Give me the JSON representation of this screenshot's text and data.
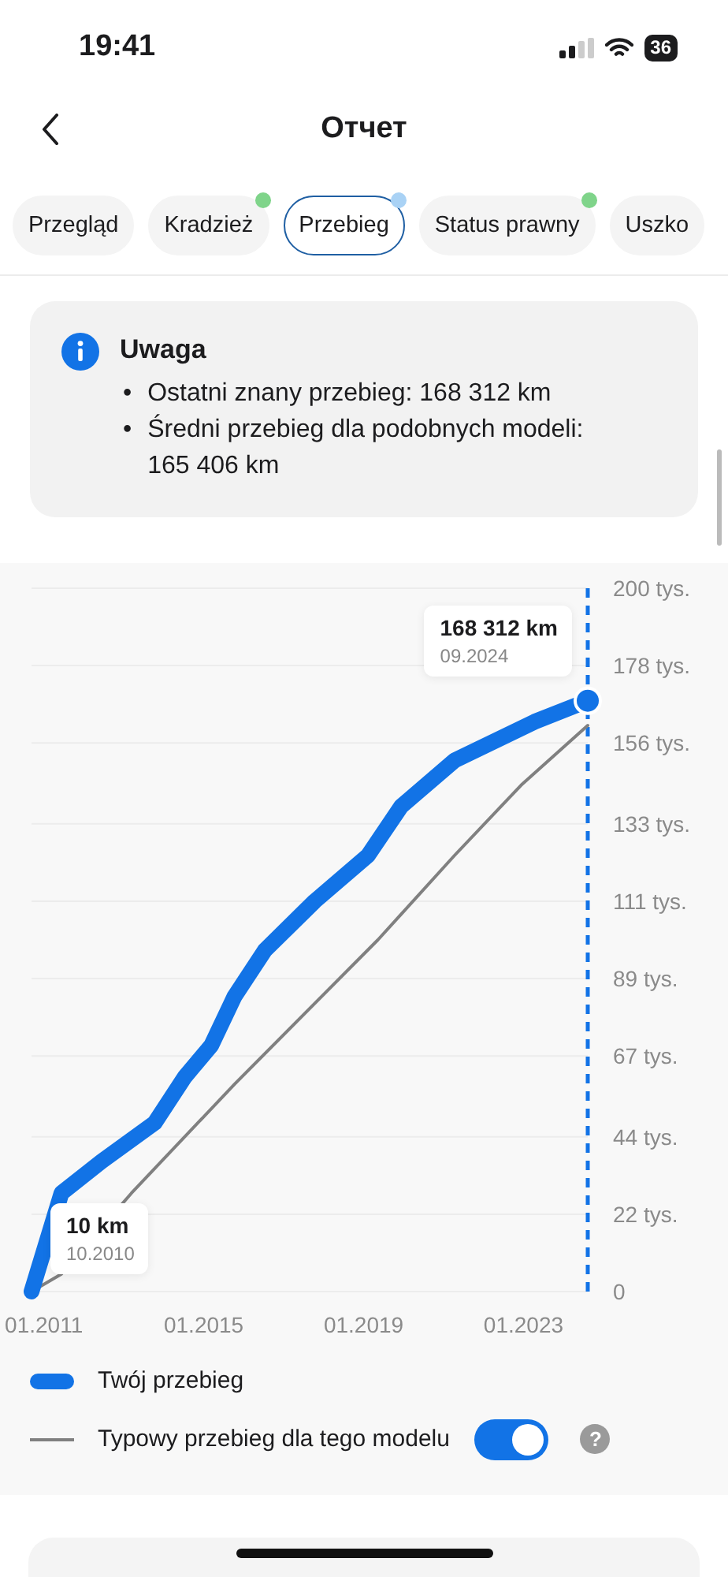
{
  "status_bar": {
    "time": "19:41",
    "battery": "36"
  },
  "header": {
    "title": "Отчет"
  },
  "tabs": [
    {
      "label": "Przegląd",
      "selected": false
    },
    {
      "label": "Kradzież",
      "selected": false,
      "color": "#7fd48a"
    },
    {
      "label": "Przebieg",
      "selected": true,
      "color": "#a9d2f5"
    },
    {
      "label": "Status prawny",
      "selected": false,
      "color": "#7fd48a"
    },
    {
      "label": "Uszko",
      "selected": false
    }
  ],
  "notice": {
    "title": "Uwaga",
    "items": [
      {
        "marker": "•",
        "text": "Ostatni znany przebieg: 168 312 km"
      },
      {
        "marker": "•",
        "text": "Średni przebieg dla podobnych modeli: 165 406 km"
      }
    ]
  },
  "chart": {
    "chart_data": {
      "type": "line",
      "grid": true,
      "xlim": [
        "2010-10",
        "2024-09"
      ],
      "ylim": [
        0,
        200
      ],
      "ref_lines": [
        {
          "axis": "x",
          "value": "2024-09",
          "color": "#1273e6"
        }
      ],
      "xticks": [
        {
          "value": "2011-01",
          "label": "01.2011"
        },
        {
          "value": "2015-01",
          "label": "01.2015"
        },
        {
          "value": "2019-01",
          "label": "01.2019"
        },
        {
          "value": "2023-01",
          "label": "01.2023"
        }
      ],
      "yticks": [
        {
          "value": 0,
          "label": "0"
        },
        {
          "value": 22,
          "label": "22 tys."
        },
        {
          "value": 44,
          "label": "44 tys."
        },
        {
          "value": 67,
          "label": "67 tys."
        },
        {
          "value": 89,
          "label": "89 tys."
        },
        {
          "value": 111,
          "label": "111 tys."
        },
        {
          "value": 133,
          "label": "133 tys."
        },
        {
          "value": 156,
          "label": "156 tys."
        },
        {
          "value": 178,
          "label": "178 tys."
        },
        {
          "value": 200,
          "label": "200 tys."
        }
      ],
      "series": [
        {
          "name": "Twój przebieg",
          "color": "#1273e6",
          "x": [
            "2010-10",
            "2011-07",
            "2012-07",
            "2013-11",
            "2014-08",
            "2015-04",
            "2015-11",
            "2016-08",
            "2017-11",
            "2019-03",
            "2020-01",
            "2021-05",
            "2023-05",
            "2024-09"
          ],
          "values": [
            0,
            28,
            37,
            48,
            61,
            70,
            84,
            97,
            111,
            124,
            138,
            151,
            162,
            168
          ]
        },
        {
          "name": "Typowy przebieg dla tego modelu",
          "color": "#808080",
          "x": [
            "2010-10",
            "2011-07",
            "2013-04",
            "2015-11",
            "2019-06",
            "2021-05",
            "2023-01",
            "2024-09"
          ],
          "values": [
            0,
            5,
            28,
            59,
            100,
            124,
            144,
            161
          ]
        }
      ]
    },
    "tooltips": [
      {
        "value": "168 312 km",
        "date": "09.2024"
      },
      {
        "value": "10 km",
        "date": "10.2010"
      }
    ],
    "legend": {
      "toggle_on": true,
      "help": "?"
    }
  }
}
